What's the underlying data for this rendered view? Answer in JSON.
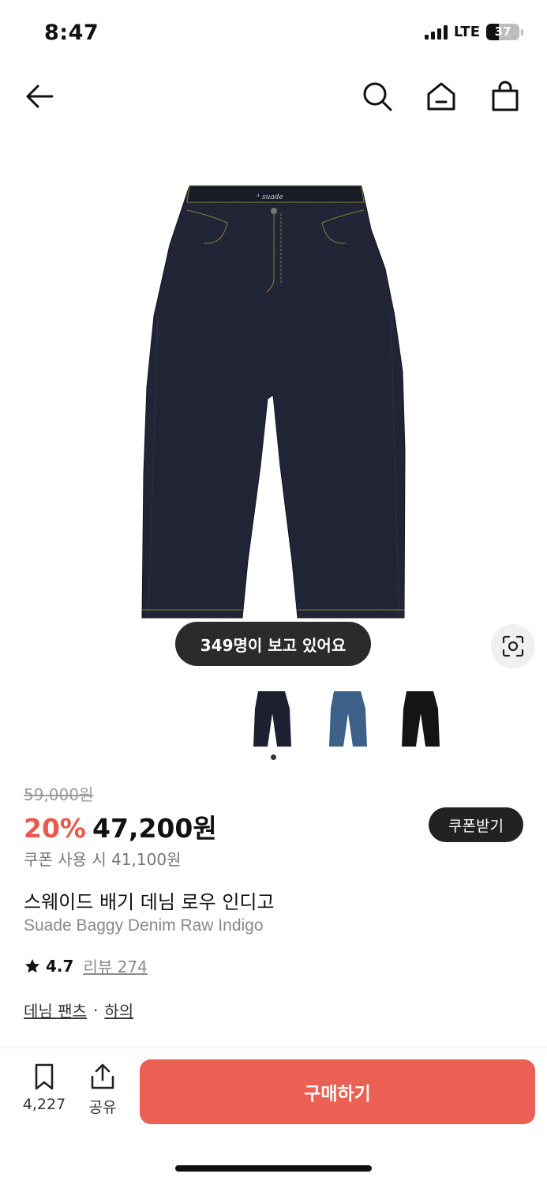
{
  "status": {
    "time": "8:47",
    "network": "LTE",
    "battery": "37",
    "battery_level": 0.37
  },
  "nav": {
    "icons": [
      "back-arrow-icon",
      "search-icon",
      "home-icon",
      "shopping-bag-icon"
    ]
  },
  "hero": {
    "viewers_text": "349명이 보고 있어요"
  },
  "thumbnails": [
    {
      "variant": "raw indigo",
      "color": "#1c2030"
    },
    {
      "variant": "mid blue",
      "color": "#3d6189"
    },
    {
      "variant": "black",
      "color": "#141414"
    }
  ],
  "pricing": {
    "original": "59,000원",
    "discount": "20%",
    "sale": "47,200원",
    "coupon_button": "쿠폰받기",
    "coupon_price": "쿠폰 사용 시 41,100원"
  },
  "product": {
    "title_ko": "스웨이드 배기 데님 로우 인디고",
    "title_en": "Suade Baggy Denim Raw Indigo",
    "rating": "4.7",
    "reviews": "리뷰 274",
    "category": "데님 팬츠",
    "category_sep": "·",
    "subcategory": "하의"
  },
  "bottom": {
    "bookmark_count": "4,227",
    "share_label": "공유",
    "buy_label": "구매하기"
  },
  "colors": {
    "accent": "#ec5f53",
    "discount": "#e8594c",
    "dark": "#222222"
  }
}
